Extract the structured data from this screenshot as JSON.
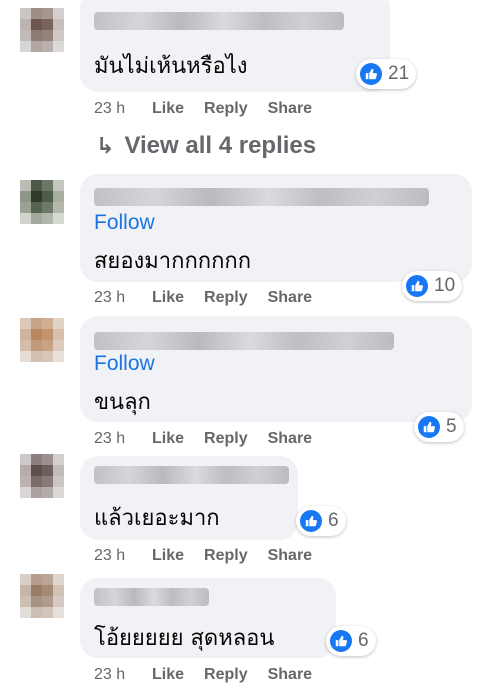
{
  "comments": [
    {
      "text": "มันไม่เห้นหรือไง",
      "follow": "",
      "reactions": "21",
      "time": "23 h"
    },
    {
      "text": "สยองมากกกกกก",
      "follow": "Follow",
      "reactions": "10",
      "time": "23 h"
    },
    {
      "text": "ขนลุก",
      "follow": "Follow",
      "reactions": "5",
      "time": "23 h"
    },
    {
      "text": "แล้วเยอะมาก",
      "follow": "",
      "reactions": "6",
      "time": "23 h"
    },
    {
      "text": "โอ้ยยยยย สุดหลอน",
      "follow": "",
      "reactions": "6",
      "time": "23 h"
    }
  ],
  "actions": {
    "like": "Like",
    "reply": "Reply",
    "share": "Share"
  },
  "view_replies": "View all 4 replies",
  "colors": {
    "accent": "#1b74e4",
    "bubble": "#f0f2f5",
    "muted": "#65676b",
    "like_blue": "#1877f2"
  },
  "icons": {
    "reaction": "like-thumb-icon",
    "reply": "reply-arrow-icon"
  }
}
